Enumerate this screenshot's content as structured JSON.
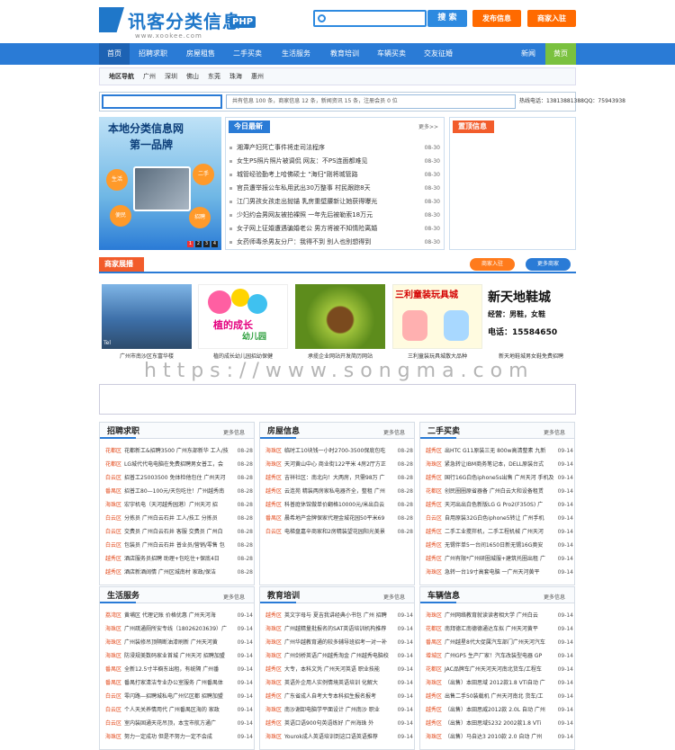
{
  "header": {
    "logo_title": "讯客分类信息",
    "logo_badge": "PHP",
    "logo_url": "www.xookee.com",
    "search_placeholder": "",
    "search_button": "搜 索",
    "post_button": "发布信息",
    "merchant_button": "商家入驻"
  },
  "nav": {
    "items": [
      "首页",
      "招聘求职",
      "房屋租售",
      "二手买卖",
      "生活服务",
      "教育培训",
      "车辆买卖",
      "交友征婚"
    ],
    "right": [
      "新闻",
      "黄页"
    ]
  },
  "area": {
    "label": "地区导航",
    "items": [
      "广州",
      "深圳",
      "佛山",
      "东莞",
      "珠海",
      "惠州"
    ]
  },
  "stats": {
    "text": "共有信息 100 条，商家信息 12 条，新闻资讯 15 条，注册会员 0 位",
    "tel": "热线电话：13813881388QQ：75943938"
  },
  "banner": {
    "line1": "本地分类信息网",
    "line2": "第一品牌",
    "badges": [
      "生活",
      "二手",
      "便民",
      "招聘"
    ],
    "pages": [
      "1",
      "2",
      "3",
      "4"
    ]
  },
  "news": {
    "title": "今日最新",
    "more": "更多>>",
    "items": [
      {
        "t": "湘潭产妇死亡事件将走司法程序",
        "d": "08-30"
      },
      {
        "t": "女生PS照片照片被调侃 网友：不PS连面都难见",
        "d": "08-30"
      },
      {
        "t": "城管经验勤考上哈佛硕士 \"海归\"刚将城管路",
        "d": "08-30"
      },
      {
        "t": "官员遭举报公车私用武出30万整事 村民跟踪8天",
        "d": "08-30"
      },
      {
        "t": "江门男孩女孩走出抛锚 乳房重壁腰新让她获得曝光",
        "d": "08-30"
      },
      {
        "t": "少妇约会男网友被拍裸照 一年先后被勒索18万元",
        "d": "08-30"
      },
      {
        "t": "女子网上征婚遭遇骗婚老公 男方将被不知情险离婚",
        "d": "08-30"
      },
      {
        "t": "女药师毒杀男友分尸：我得不到 别人也别想得到",
        "d": "08-30"
      }
    ]
  },
  "top_info": {
    "title": "置顶信息"
  },
  "merchants": {
    "title": "商家展播",
    "join": "商家入驻",
    "more": "更多商家",
    "cards": [
      {
        "cap": "广州市南沙区东富华楼",
        "tel": "Tel"
      },
      {
        "cap": "植的成长幼儿园招幼保健",
        "tel": ""
      },
      {
        "cap": "承揽企业网站开发简历网站",
        "tel": ""
      },
      {
        "cap": "三利童装玩具城散大品种",
        "tel": ""
      },
      {
        "cap": "新天地鞋城男女鞋免费招聘",
        "tel": "15584650"
      }
    ],
    "card2_text": [
      "植的成长",
      "幼儿园"
    ],
    "card4_text": [
      "三利童装玩具城"
    ],
    "card5_text": [
      "新天地鞋城",
      "经营：男鞋，女鞋",
      "电话：15584650"
    ]
  },
  "watermark": "https://www.songma.com",
  "columns": [
    {
      "title": "招聘求职",
      "more": "更多信息",
      "items": [
        {
          "r": "花都区",
          "t": "花都新工&招聘3500 广州东部新华 工人/技",
          "d": "08-28"
        },
        {
          "r": "花都区",
          "t": "LG城代代电电脑在免费招聘男女普工，会",
          "d": "08-28"
        },
        {
          "r": "白云区",
          "t": "招普工25003500 免体检他包住 广州天河",
          "d": "08-28"
        },
        {
          "r": "番禺区",
          "t": "招普工80—100元/天包吃住！广州越秀南",
          "d": "08-28"
        },
        {
          "r": "海珠区",
          "t": "宏宇机电（天河越秀园港）广州天河 招",
          "d": "08-28"
        },
        {
          "r": "白云区",
          "t": "分拣员 广州白云石井 工人/技工 分拣员",
          "d": "08-28"
        },
        {
          "r": "白云区",
          "t": "交费员 广州白云石井 客服 交费员 广州白",
          "d": "08-28"
        },
        {
          "r": "白云区",
          "t": "包装员 广州白云石井 普业员/营销/零售 包",
          "d": "08-28"
        },
        {
          "r": "越秀区",
          "t": "酒店服务员招聘 助理+包吃住+保底4日",
          "d": "08-28"
        },
        {
          "r": "越秀区",
          "t": "酒店新酒阔情 广州区城南村 家政/保洁",
          "d": "08-28"
        }
      ]
    },
    {
      "title": "房屋信息",
      "more": "更多信息",
      "items": [
        {
          "r": "海珠区",
          "t": "临时工10块钱一小时2700-3500保底包吃",
          "d": "08-28"
        },
        {
          "r": "海珠区",
          "t": "天河黄山中心 商业街122平米 4房2厅方正",
          "d": "08-28"
        },
        {
          "r": "越秀区",
          "t": "吉祥社区：南北向！大两房，只需98万 广",
          "d": "08-28"
        },
        {
          "r": "越秀区",
          "t": "云连苑 精装两房家私电器齐全，整租 广州",
          "d": "08-28"
        },
        {
          "r": "越秀区",
          "t": "科普庭休馆做单价翻格10000元/米出白云",
          "d": "08-28"
        },
        {
          "r": "番禺区",
          "t": "晨希地产金牌保家代理金城花园50平米69",
          "d": "08-28"
        },
        {
          "r": "白云区",
          "t": "电梯盘嘉辛商家和2房精装望花园阳光美景",
          "d": "08-28"
        }
      ]
    },
    {
      "title": "二手买卖",
      "more": "更多信息",
      "items": [
        {
          "r": "越秀区",
          "t": "出HTC G11原装三无 800w高清整素 九新",
          "d": "09-14"
        },
        {
          "r": "海珠区",
          "t": "紧急转让IBM商务笔记本，DELL原装台式",
          "d": "09-14"
        },
        {
          "r": "越秀区",
          "t": "国行16G白色iphone5s出售 广州天河 手机及",
          "d": "09-14"
        },
        {
          "r": "花都区",
          "t": "创民圈圈原省器备 广州白云大和设备租赁",
          "d": "09-14"
        },
        {
          "r": "越秀区",
          "t": "天河出出白色新版LG G Pro2(F350S) 广",
          "d": "09-14"
        },
        {
          "r": "白云区",
          "t": "自用原装32G白色iphone5转让 广州手机",
          "d": "09-14"
        },
        {
          "r": "越秀区",
          "t": "二手工业搅拌机，二手工程机械 广州天河",
          "d": "09-14"
        },
        {
          "r": "越秀区",
          "t": "无锡伴单5一台间1650日新无锡16G奥安",
          "d": "09-14"
        },
        {
          "r": "越秀区",
          "t": "广州有限*广州研圈城服+建筑托圈出租 广",
          "d": "09-14"
        },
        {
          "r": "海珠区",
          "t": "急转一台19寸高套电脑 一广州天河黄平",
          "d": "09-14"
        }
      ]
    },
    {
      "title": "生活服务",
      "more": "更多信息",
      "items": [
        {
          "r": "荔湾区",
          "t": "黄埔区 代理记账 价格优惠 广州天河海",
          "d": "09-14"
        },
        {
          "r": "海珠区",
          "t": "广州疏通厕所安专线（18026203639）广",
          "d": "09-14"
        },
        {
          "r": "海珠区",
          "t": "广州装修吊顶隔断油漆刷新 广州天河黄",
          "d": "09-14"
        },
        {
          "r": "海珠区",
          "t": "防浸规美数码家业首城 广州天河 招聘加盟",
          "d": "09-14"
        },
        {
          "r": "番禺区",
          "t": "全新12.5寸半橱东出租，有统隔 广州番",
          "d": "09-14"
        },
        {
          "r": "番禺区",
          "t": "番禺打家清洁专业办公室服务 广州番禺体",
          "d": "09-14"
        },
        {
          "r": "白云区",
          "t": "零闪路—招聘城私电广州亿区都 招聘加盟",
          "d": "09-14"
        },
        {
          "r": "白云区",
          "t": "个人天关养情用代 广州番禺区海的 家政",
          "d": "09-14"
        },
        {
          "r": "白云区",
          "t": "室内装固通天花吊顶，本宝市航方通广",
          "d": "09-14"
        },
        {
          "r": "海珠区",
          "t": "努力一定成功 但是不努力一定不会成",
          "d": "09-14"
        }
      ]
    },
    {
      "title": "教育培训",
      "more": "更多信息",
      "items": [
        {
          "r": "越秀区",
          "t": "英文字母与 夏吉我讲经典小书包 广州 招聘",
          "d": "09-14"
        },
        {
          "r": "海珠区",
          "t": "广州越精量批报名的SAT英语培训机构推荐",
          "d": "09-14"
        },
        {
          "r": "海珠区",
          "t": "广州华越教育通的较多辅导班招考一对一补",
          "d": "09-14"
        },
        {
          "r": "海珠区",
          "t": "广州剑桥英语广州越秀淘金 广州越秀电脑校",
          "d": "09-14"
        },
        {
          "r": "越秀区",
          "t": "大专，本科文凭 广州天河英语 职业技能",
          "d": "09-14"
        },
        {
          "r": "海珠区",
          "t": "英语外企用人实例情境英语培训 化解大",
          "d": "09-14"
        },
        {
          "r": "越秀区",
          "t": "广东省成人自考大专本科招生报名报考",
          "d": "09-14"
        },
        {
          "r": "海珠区",
          "t": "南沙谢卸电脑学平面设计 广州南沙 职业",
          "d": "09-14"
        },
        {
          "r": "越秀区",
          "t": "英语口语900句英语练好 广州海珠 外",
          "d": "09-14"
        },
        {
          "r": "海珠区",
          "t": "Yourok成人英语培训到这口语英语推荐",
          "d": "09-14"
        }
      ]
    },
    {
      "title": "车辆信息",
      "more": "更多信息",
      "items": [
        {
          "r": "海珠区",
          "t": "广州网络教育就读读者相大学 广州白云",
          "d": "09-14"
        },
        {
          "r": "花都区",
          "t": "南拜德汇南德德通达车拟 广州天河黄平",
          "d": "09-14"
        },
        {
          "r": "番禺区",
          "t": "广州越星8代大促属汽车部门广州天河汽车",
          "d": "09-14"
        },
        {
          "r": "增城区",
          "t": "广州GP5 生产厂家！汽车改装型电器 GP",
          "d": "09-14"
        },
        {
          "r": "花都区",
          "t": "JAC品牌车广州天河天河南北货车/工程车",
          "d": "09-14"
        },
        {
          "r": "海珠区",
          "t": "（出售）本田思域 2012款1.8 VTi自动 广",
          "d": "09-14"
        },
        {
          "r": "越秀区",
          "t": "出售二手50装载机 广州天河南北 货车/工",
          "d": "09-14"
        },
        {
          "r": "越秀区",
          "t": "（出售）本田思威2012款 2.0L 自动 广州",
          "d": "09-14"
        },
        {
          "r": "越秀区",
          "t": "（出售）本田思域5232 2002款1.8 VTi",
          "d": "09-14"
        },
        {
          "r": "海珠区",
          "t": "（出售）马自达3 2010款 2.0 自动 广州",
          "d": "09-14"
        }
      ]
    }
  ]
}
